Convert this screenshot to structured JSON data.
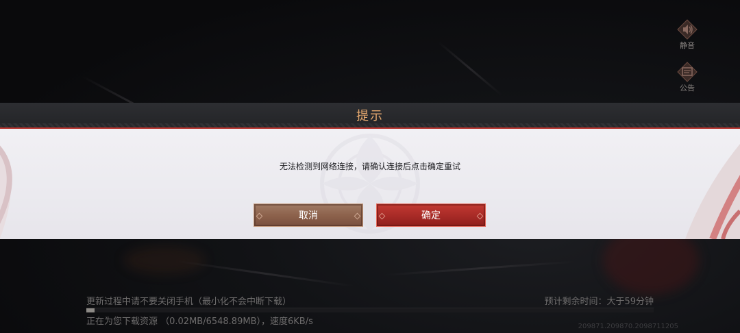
{
  "side_buttons": {
    "mute_label": "静音",
    "notice_label": "公告"
  },
  "dialog": {
    "title": "提示",
    "message": "无法检测到网络连接，请确认连接后点击确定重试",
    "cancel_label": "取消",
    "confirm_label": "确定"
  },
  "status": {
    "notice": "更新过程中请不要关闭手机（最小化不会中断下载）",
    "eta": "预计剩余时间：大于59分钟",
    "download": "正在为您下载资源 （0.02MB/6548.89MB），速度6KB/s",
    "progress_fraction": 3.1e-06,
    "version": "209871.209870.2098711205"
  },
  "colors": {
    "title": "#e6a96f",
    "accent_red": "#b8342f",
    "cancel_btn": "#8b604a",
    "confirm_btn": "#a72a26"
  }
}
